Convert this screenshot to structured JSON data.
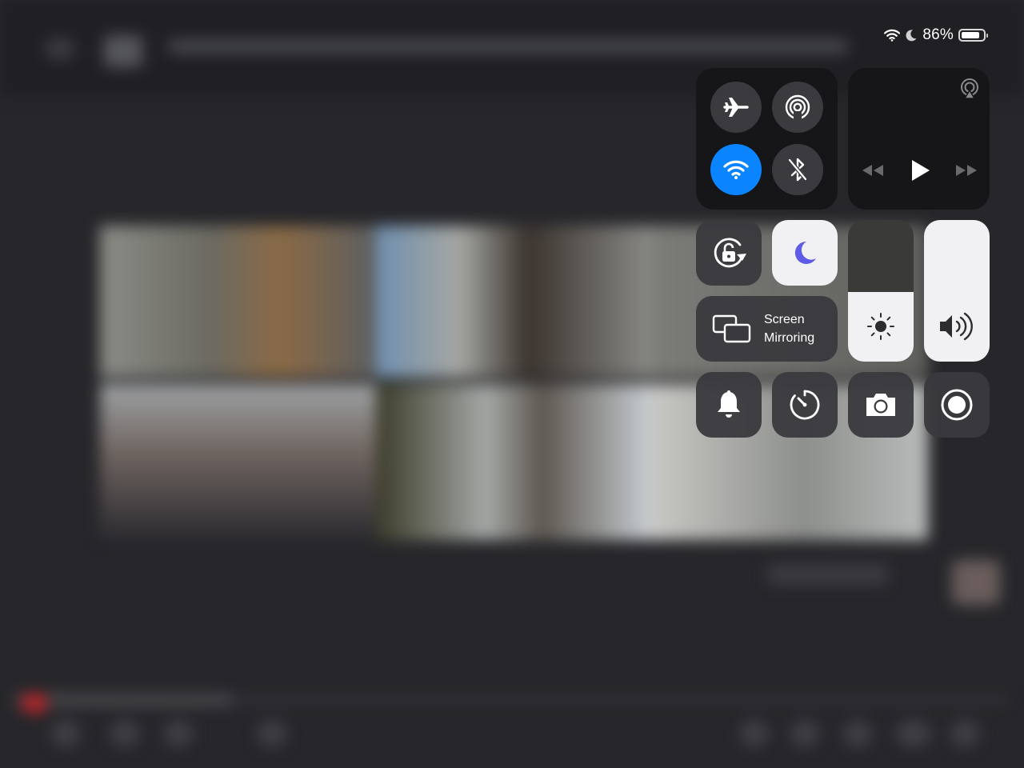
{
  "status_bar": {
    "wifi_icon": "wifi-icon",
    "moon_icon": "moon-icon",
    "battery_percent_text": "86%",
    "battery_level": 0.86
  },
  "control_center": {
    "connectivity": {
      "airplane_mode": {
        "icon": "airplane-icon",
        "on": false
      },
      "airdrop": {
        "icon": "airdrop-icon",
        "on": false
      },
      "wifi": {
        "icon": "wifi-icon",
        "on": true,
        "color": "#0a84ff"
      },
      "bluetooth": {
        "icon": "bluetooth-off-icon",
        "on": false
      }
    },
    "now_playing": {
      "airplay_icon": "airplay-audio-icon",
      "rewind_icon": "rewind-icon",
      "play_icon": "play-icon",
      "fast_forward_icon": "fast-forward-icon"
    },
    "orientation_lock": {
      "icon": "orientation-lock-icon",
      "on": false
    },
    "do_not_disturb": {
      "icon": "moon-icon",
      "on": true,
      "color": "#5e5ce6"
    },
    "screen_mirroring": {
      "icon": "screen-mirroring-icon",
      "label_line1": "Screen",
      "label_line2": "Mirroring"
    },
    "brightness": {
      "icon": "sun-icon",
      "level": 0.49
    },
    "volume": {
      "icon": "speaker-icon",
      "level": 1.0
    },
    "bottom_row": [
      {
        "name": "notifications",
        "icon": "bell-icon"
      },
      {
        "name": "timer",
        "icon": "timer-icon"
      },
      {
        "name": "camera",
        "icon": "camera-icon"
      },
      {
        "name": "screen-recording",
        "icon": "record-icon"
      }
    ]
  }
}
